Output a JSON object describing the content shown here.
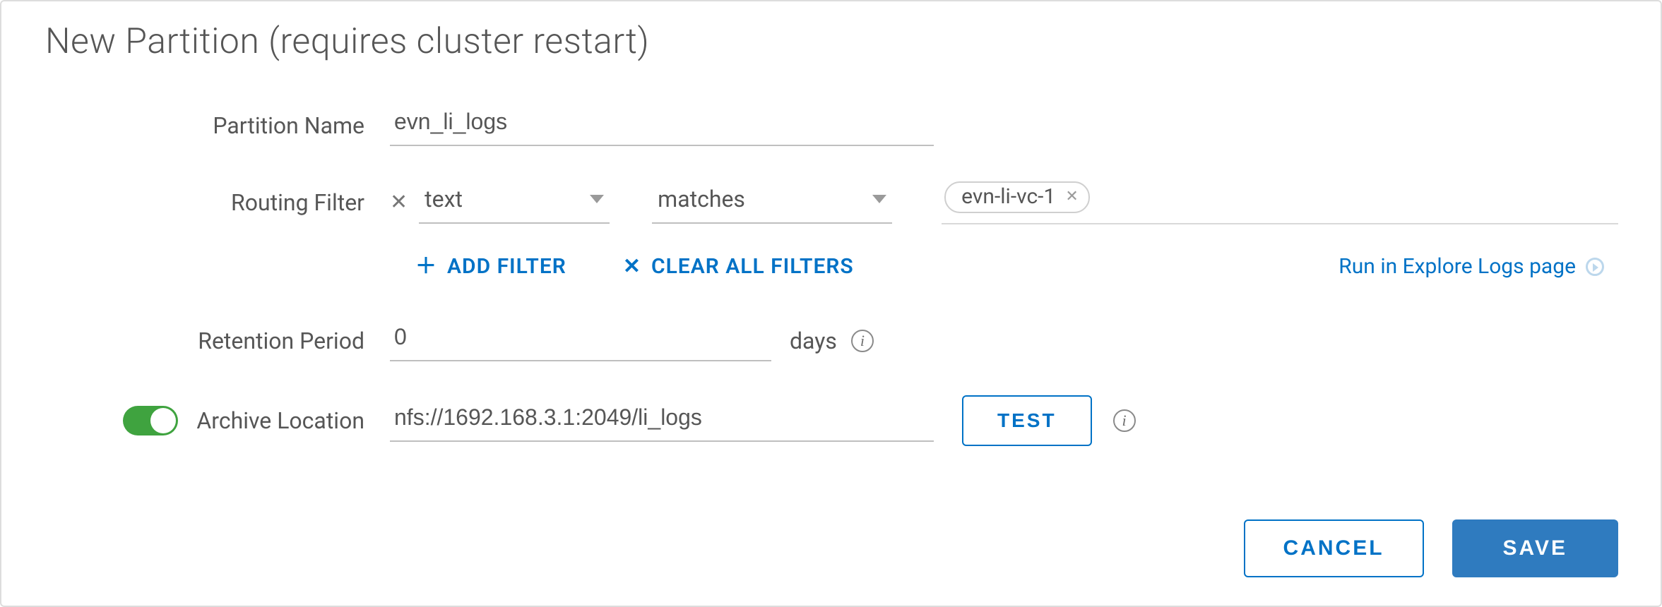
{
  "title": "New Partition (requires cluster restart)",
  "labels": {
    "partition_name": "Partition Name",
    "routing_filter": "Routing Filter",
    "retention_period": "Retention Period",
    "archive_location": "Archive Location"
  },
  "partition_name_value": "evn_li_logs",
  "routing_filter": {
    "field": "text",
    "operator": "matches",
    "tags": [
      "evn-li-vc-1"
    ]
  },
  "actions": {
    "add_filter": "ADD FILTER",
    "clear_all_filters": "CLEAR ALL FILTERS",
    "run_in_explore": "Run in Explore Logs page"
  },
  "retention": {
    "value": "0",
    "unit": "days"
  },
  "archive": {
    "enabled": true,
    "value": "nfs://1692.168.3.1:2049/li_logs",
    "test_label": "TEST"
  },
  "footer": {
    "cancel": "CANCEL",
    "save": "SAVE"
  }
}
